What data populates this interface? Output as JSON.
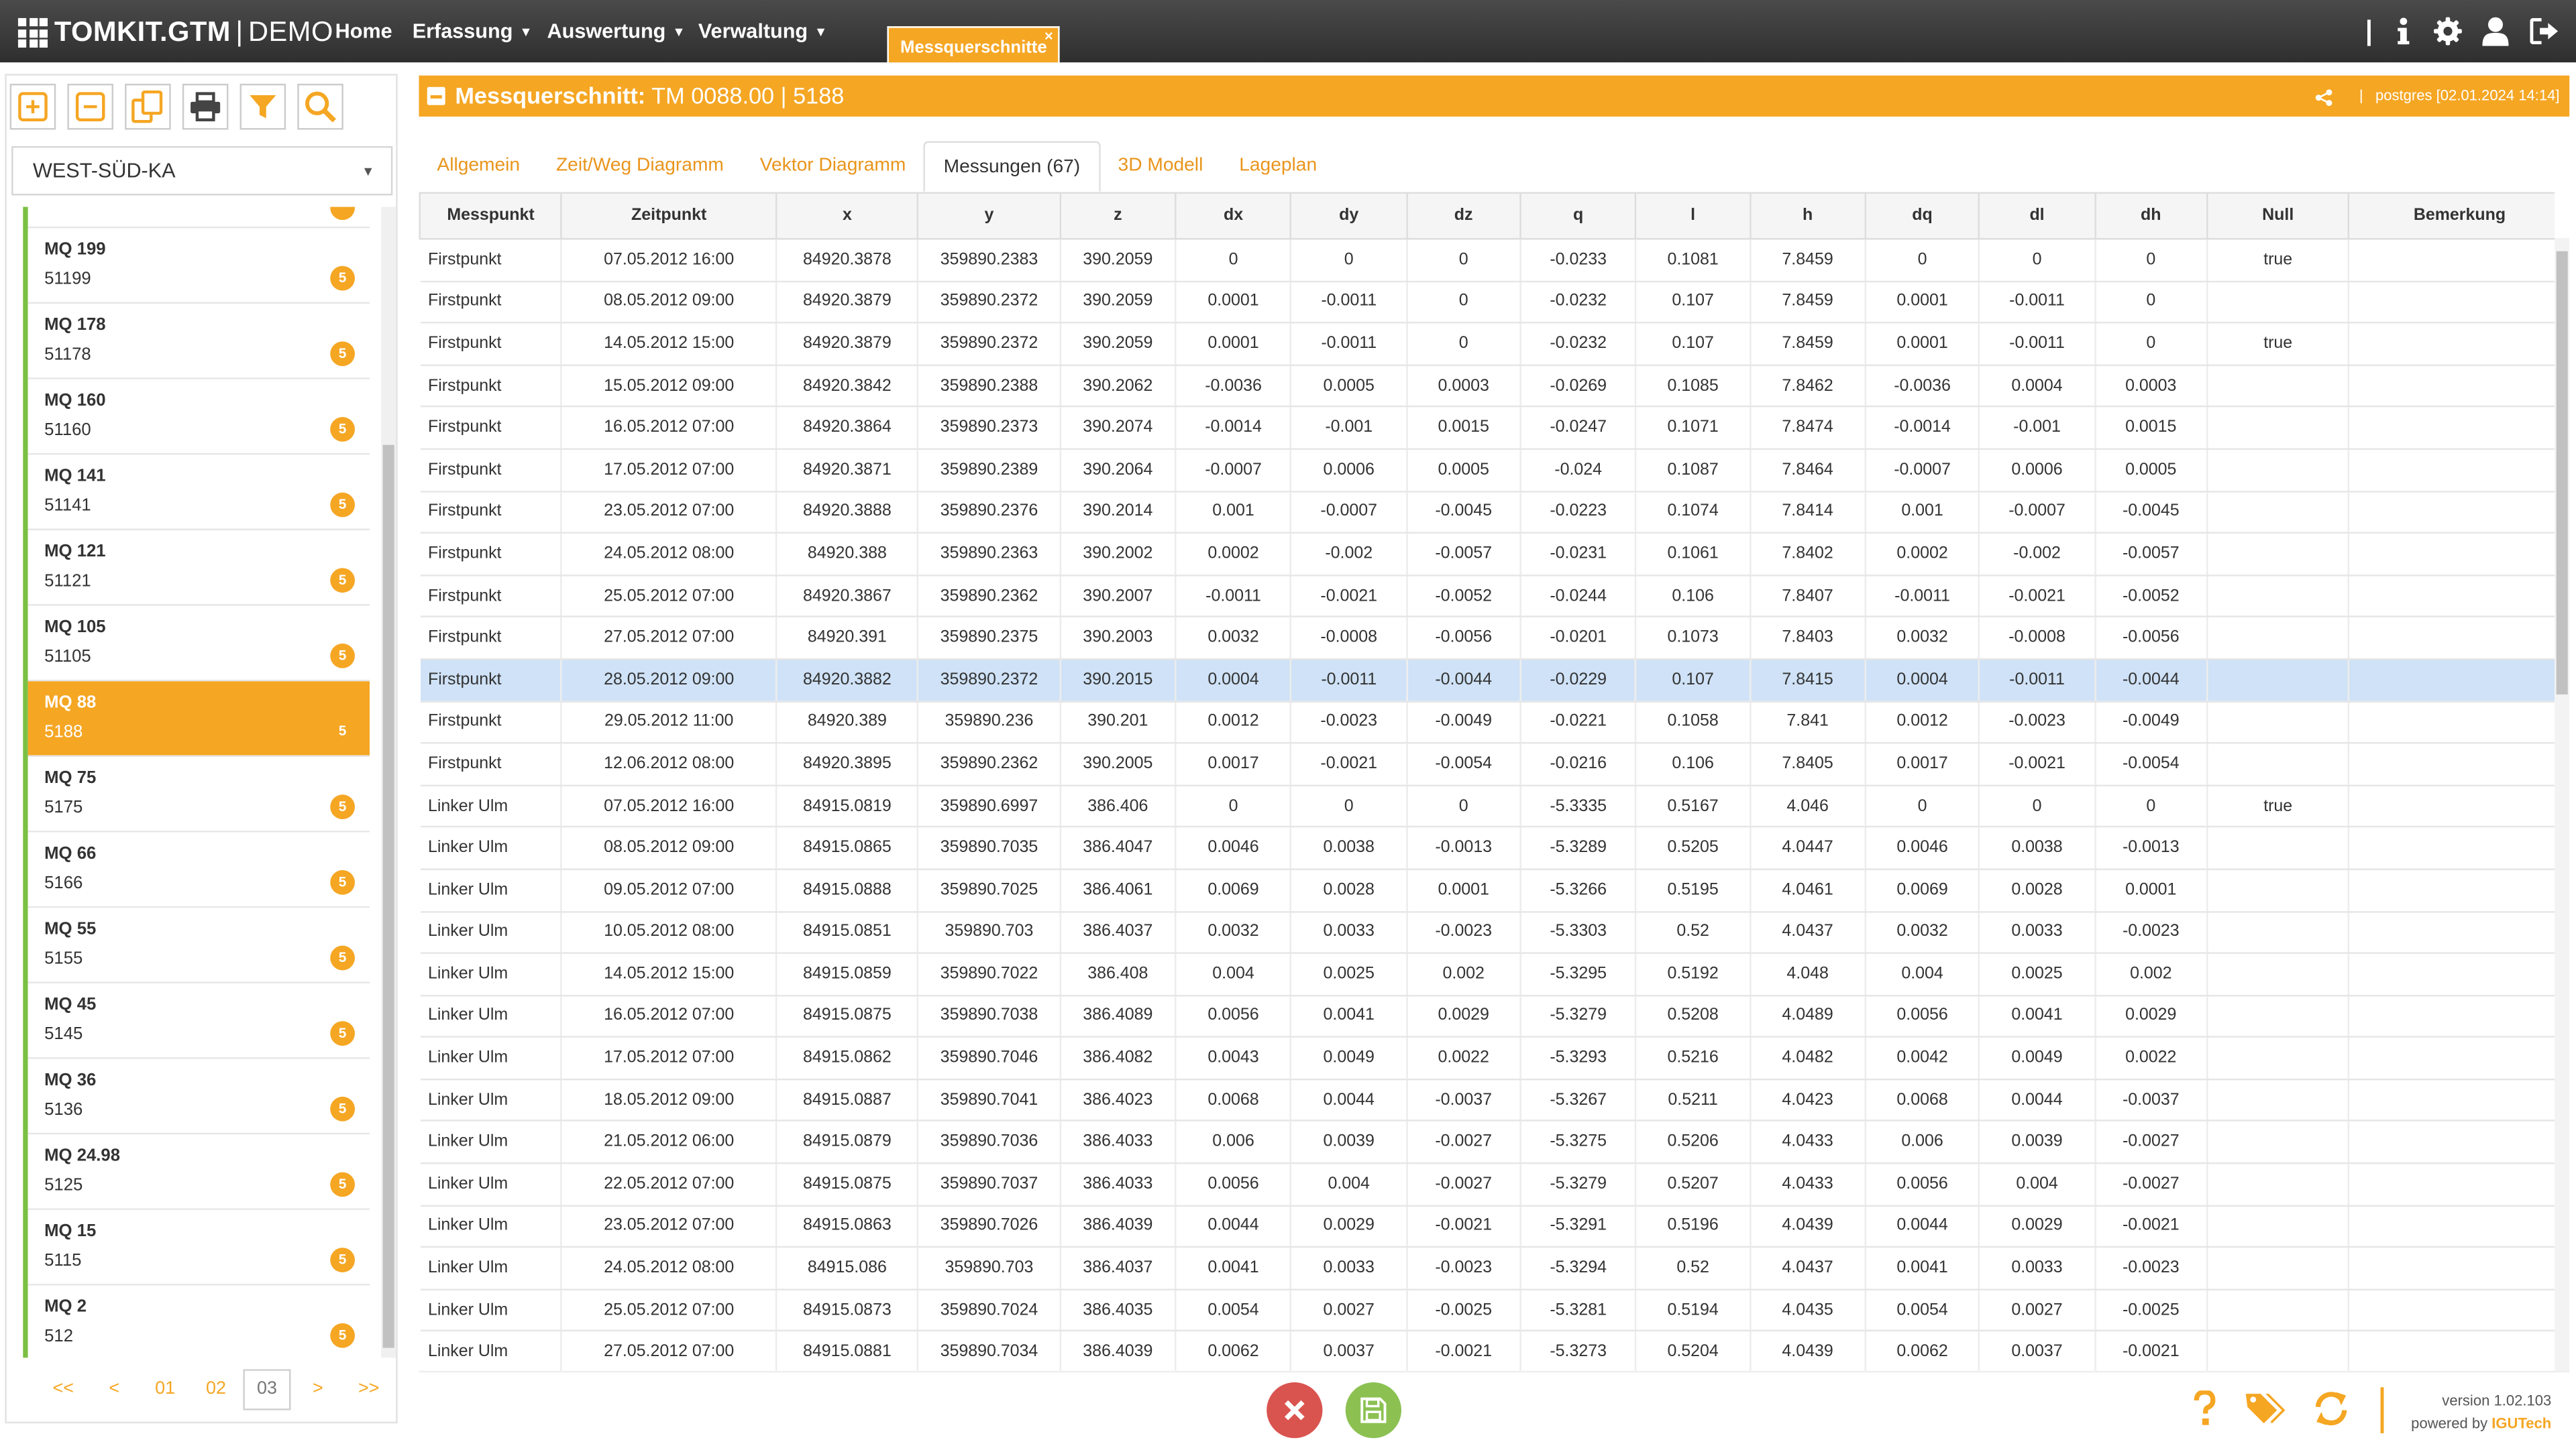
{
  "app": {
    "name": "TOMKIT.GTM",
    "sep": "|",
    "env": "DEMO"
  },
  "nav": {
    "home": "Home",
    "erfassung": "Erfassung",
    "auswertung": "Auswertung",
    "verwaltung": "Verwaltung"
  },
  "open_tab": {
    "label": "Messquerschnitte",
    "close": "×"
  },
  "sidebar": {
    "select_value": "WEST-SÜD-KA",
    "items": [
      {
        "name": "MQ 199",
        "code": "51199",
        "count": "5"
      },
      {
        "name": "MQ 178",
        "code": "51178",
        "count": "5"
      },
      {
        "name": "MQ 160",
        "code": "51160",
        "count": "5"
      },
      {
        "name": "MQ 141",
        "code": "51141",
        "count": "5"
      },
      {
        "name": "MQ 121",
        "code": "51121",
        "count": "5"
      },
      {
        "name": "MQ 105",
        "code": "51105",
        "count": "5"
      },
      {
        "name": "MQ 88",
        "code": "5188",
        "count": "5"
      },
      {
        "name": "MQ 75",
        "code": "5175",
        "count": "5"
      },
      {
        "name": "MQ 66",
        "code": "5166",
        "count": "5"
      },
      {
        "name": "MQ 55",
        "code": "5155",
        "count": "5"
      },
      {
        "name": "MQ 45",
        "code": "5145",
        "count": "5"
      },
      {
        "name": "MQ 36",
        "code": "5136",
        "count": "5"
      },
      {
        "name": "MQ 24.98",
        "code": "5125",
        "count": "5"
      },
      {
        "name": "MQ 15",
        "code": "5115",
        "count": "5"
      },
      {
        "name": "MQ 2",
        "code": "512",
        "count": "5"
      }
    ],
    "active_index": 6,
    "pager": [
      "<<",
      "<",
      "01",
      "02",
      "03",
      ">",
      ">>"
    ],
    "pager_current": "03"
  },
  "panel": {
    "title_bold": "Messquerschnitt:",
    "title_rest": " TM 0088.00 | 5188",
    "meta": "postgres [02.01.2024 14:14]"
  },
  "tabs": [
    "Allgemein",
    "Zeit/Weg Diagramm",
    "Vektor Diagramm",
    "Messungen (67)",
    "3D Modell",
    "Lageplan"
  ],
  "active_tab": 3,
  "table": {
    "columns": [
      "Messpunkt",
      "Zeitpunkt",
      "x",
      "y",
      "z",
      "dx",
      "dy",
      "dz",
      "q",
      "l",
      "h",
      "dq",
      "dl",
      "dh",
      "Null",
      "Bemerkung"
    ],
    "selected_row": 10,
    "rows": [
      [
        "Firstpunkt",
        "07.05.2012 16:00",
        "84920.3878",
        "359890.2383",
        "390.2059",
        "0",
        "0",
        "0",
        "-0.0233",
        "0.1081",
        "7.8459",
        "0",
        "0",
        "0",
        "true",
        ""
      ],
      [
        "Firstpunkt",
        "08.05.2012 09:00",
        "84920.3879",
        "359890.2372",
        "390.2059",
        "0.0001",
        "-0.0011",
        "0",
        "-0.0232",
        "0.107",
        "7.8459",
        "0.0001",
        "-0.0011",
        "0",
        "",
        ""
      ],
      [
        "Firstpunkt",
        "14.05.2012 15:00",
        "84920.3879",
        "359890.2372",
        "390.2059",
        "0.0001",
        "-0.0011",
        "0",
        "-0.0232",
        "0.107",
        "7.8459",
        "0.0001",
        "-0.0011",
        "0",
        "true",
        ""
      ],
      [
        "Firstpunkt",
        "15.05.2012 09:00",
        "84920.3842",
        "359890.2388",
        "390.2062",
        "-0.0036",
        "0.0005",
        "0.0003",
        "-0.0269",
        "0.1085",
        "7.8462",
        "-0.0036",
        "0.0004",
        "0.0003",
        "",
        ""
      ],
      [
        "Firstpunkt",
        "16.05.2012 07:00",
        "84920.3864",
        "359890.2373",
        "390.2074",
        "-0.0014",
        "-0.001",
        "0.0015",
        "-0.0247",
        "0.1071",
        "7.8474",
        "-0.0014",
        "-0.001",
        "0.0015",
        "",
        ""
      ],
      [
        "Firstpunkt",
        "17.05.2012 07:00",
        "84920.3871",
        "359890.2389",
        "390.2064",
        "-0.0007",
        "0.0006",
        "0.0005",
        "-0.024",
        "0.1087",
        "7.8464",
        "-0.0007",
        "0.0006",
        "0.0005",
        "",
        ""
      ],
      [
        "Firstpunkt",
        "23.05.2012 07:00",
        "84920.3888",
        "359890.2376",
        "390.2014",
        "0.001",
        "-0.0007",
        "-0.0045",
        "-0.0223",
        "0.1074",
        "7.8414",
        "0.001",
        "-0.0007",
        "-0.0045",
        "",
        ""
      ],
      [
        "Firstpunkt",
        "24.05.2012 08:00",
        "84920.388",
        "359890.2363",
        "390.2002",
        "0.0002",
        "-0.002",
        "-0.0057",
        "-0.0231",
        "0.1061",
        "7.8402",
        "0.0002",
        "-0.002",
        "-0.0057",
        "",
        ""
      ],
      [
        "Firstpunkt",
        "25.05.2012 07:00",
        "84920.3867",
        "359890.2362",
        "390.2007",
        "-0.0011",
        "-0.0021",
        "-0.0052",
        "-0.0244",
        "0.106",
        "7.8407",
        "-0.0011",
        "-0.0021",
        "-0.0052",
        "",
        ""
      ],
      [
        "Firstpunkt",
        "27.05.2012 07:00",
        "84920.391",
        "359890.2375",
        "390.2003",
        "0.0032",
        "-0.0008",
        "-0.0056",
        "-0.0201",
        "0.1073",
        "7.8403",
        "0.0032",
        "-0.0008",
        "-0.0056",
        "",
        ""
      ],
      [
        "Firstpunkt",
        "28.05.2012 09:00",
        "84920.3882",
        "359890.2372",
        "390.2015",
        "0.0004",
        "-0.0011",
        "-0.0044",
        "-0.0229",
        "0.107",
        "7.8415",
        "0.0004",
        "-0.0011",
        "-0.0044",
        "",
        ""
      ],
      [
        "Firstpunkt",
        "29.05.2012 11:00",
        "84920.389",
        "359890.236",
        "390.201",
        "0.0012",
        "-0.0023",
        "-0.0049",
        "-0.0221",
        "0.1058",
        "7.841",
        "0.0012",
        "-0.0023",
        "-0.0049",
        "",
        ""
      ],
      [
        "Firstpunkt",
        "12.06.2012 08:00",
        "84920.3895",
        "359890.2362",
        "390.2005",
        "0.0017",
        "-0.0021",
        "-0.0054",
        "-0.0216",
        "0.106",
        "7.8405",
        "0.0017",
        "-0.0021",
        "-0.0054",
        "",
        ""
      ],
      [
        "Linker Ulm",
        "07.05.2012 16:00",
        "84915.0819",
        "359890.6997",
        "386.406",
        "0",
        "0",
        "0",
        "-5.3335",
        "0.5167",
        "4.046",
        "0",
        "0",
        "0",
        "true",
        ""
      ],
      [
        "Linker Ulm",
        "08.05.2012 09:00",
        "84915.0865",
        "359890.7035",
        "386.4047",
        "0.0046",
        "0.0038",
        "-0.0013",
        "-5.3289",
        "0.5205",
        "4.0447",
        "0.0046",
        "0.0038",
        "-0.0013",
        "",
        ""
      ],
      [
        "Linker Ulm",
        "09.05.2012 07:00",
        "84915.0888",
        "359890.7025",
        "386.4061",
        "0.0069",
        "0.0028",
        "0.0001",
        "-5.3266",
        "0.5195",
        "4.0461",
        "0.0069",
        "0.0028",
        "0.0001",
        "",
        ""
      ],
      [
        "Linker Ulm",
        "10.05.2012 08:00",
        "84915.0851",
        "359890.703",
        "386.4037",
        "0.0032",
        "0.0033",
        "-0.0023",
        "-5.3303",
        "0.52",
        "4.0437",
        "0.0032",
        "0.0033",
        "-0.0023",
        "",
        ""
      ],
      [
        "Linker Ulm",
        "14.05.2012 15:00",
        "84915.0859",
        "359890.7022",
        "386.408",
        "0.004",
        "0.0025",
        "0.002",
        "-5.3295",
        "0.5192",
        "4.048",
        "0.004",
        "0.0025",
        "0.002",
        "",
        ""
      ],
      [
        "Linker Ulm",
        "16.05.2012 07:00",
        "84915.0875",
        "359890.7038",
        "386.4089",
        "0.0056",
        "0.0041",
        "0.0029",
        "-5.3279",
        "0.5208",
        "4.0489",
        "0.0056",
        "0.0041",
        "0.0029",
        "",
        ""
      ],
      [
        "Linker Ulm",
        "17.05.2012 07:00",
        "84915.0862",
        "359890.7046",
        "386.4082",
        "0.0043",
        "0.0049",
        "0.0022",
        "-5.3293",
        "0.5216",
        "4.0482",
        "0.0042",
        "0.0049",
        "0.0022",
        "",
        ""
      ],
      [
        "Linker Ulm",
        "18.05.2012 09:00",
        "84915.0887",
        "359890.7041",
        "386.4023",
        "0.0068",
        "0.0044",
        "-0.0037",
        "-5.3267",
        "0.5211",
        "4.0423",
        "0.0068",
        "0.0044",
        "-0.0037",
        "",
        ""
      ],
      [
        "Linker Ulm",
        "21.05.2012 06:00",
        "84915.0879",
        "359890.7036",
        "386.4033",
        "0.006",
        "0.0039",
        "-0.0027",
        "-5.3275",
        "0.5206",
        "4.0433",
        "0.006",
        "0.0039",
        "-0.0027",
        "",
        ""
      ],
      [
        "Linker Ulm",
        "22.05.2012 07:00",
        "84915.0875",
        "359890.7037",
        "386.4033",
        "0.0056",
        "0.004",
        "-0.0027",
        "-5.3279",
        "0.5207",
        "4.0433",
        "0.0056",
        "0.004",
        "-0.0027",
        "",
        ""
      ],
      [
        "Linker Ulm",
        "23.05.2012 07:00",
        "84915.0863",
        "359890.7026",
        "386.4039",
        "0.0044",
        "0.0029",
        "-0.0021",
        "-5.3291",
        "0.5196",
        "4.0439",
        "0.0044",
        "0.0029",
        "-0.0021",
        "",
        ""
      ],
      [
        "Linker Ulm",
        "24.05.2012 08:00",
        "84915.086",
        "359890.703",
        "386.4037",
        "0.0041",
        "0.0033",
        "-0.0023",
        "-5.3294",
        "0.52",
        "4.0437",
        "0.0041",
        "0.0033",
        "-0.0023",
        "",
        ""
      ],
      [
        "Linker Ulm",
        "25.05.2012 07:00",
        "84915.0873",
        "359890.7024",
        "386.4035",
        "0.0054",
        "0.0027",
        "-0.0025",
        "-5.3281",
        "0.5194",
        "4.0435",
        "0.0054",
        "0.0027",
        "-0.0025",
        "",
        ""
      ],
      [
        "Linker Ulm",
        "27.05.2012 07:00",
        "84915.0881",
        "359890.7034",
        "386.4039",
        "0.0062",
        "0.0037",
        "-0.0021",
        "-5.3273",
        "0.5204",
        "4.0439",
        "0.0062",
        "0.0037",
        "-0.0021",
        "",
        ""
      ]
    ]
  },
  "footer": {
    "version": "version 1.02.103",
    "powered_by": "powered by ",
    "brand": "IGUTech"
  },
  "colors": {
    "accent": "#f5a623",
    "topbar": "#3a3a3a",
    "selected_row": "#cfe2f7",
    "active_border": "#7bc043",
    "cancel": "#d9534f",
    "save": "#8cc152"
  },
  "icons": {
    "toolbar": [
      "add-icon",
      "remove-icon",
      "copy-icon",
      "print-icon",
      "filter-icon",
      "search-icon"
    ],
    "topright": [
      "info-icon",
      "gear-icon",
      "user-icon",
      "logout-icon"
    ],
    "footer": [
      "help-icon",
      "tags-icon",
      "refresh-icon"
    ]
  }
}
